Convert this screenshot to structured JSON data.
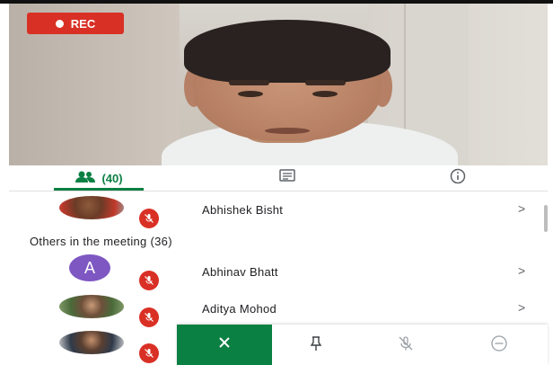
{
  "recording": {
    "label": "REC",
    "color": "#d93025"
  },
  "tabs": {
    "people": {
      "count_label": "(40)",
      "icon": "people-icon",
      "active": true
    },
    "chat": {
      "icon": "chat-icon"
    },
    "info": {
      "icon": "info-icon"
    }
  },
  "pinned_participant": {
    "name": "Abhishek Bisht",
    "muted": true
  },
  "others_section": {
    "title": "Others in the meeting (36)"
  },
  "participants": [
    {
      "name": "Abhinav Bhatt",
      "avatar_letter": "A",
      "avatar_color": "#7e57c2",
      "muted": true
    },
    {
      "name": "Aditya Mohod",
      "muted": true
    },
    {
      "name": "",
      "muted": true
    }
  ],
  "bottom_bar": {
    "close_icon": "close-icon",
    "pin_icon": "pin-icon",
    "mute_icon": "mic-off-icon",
    "more_icon": "more-icon"
  },
  "colors": {
    "accent": "#0b8043",
    "muted_badge": "#d93025"
  }
}
